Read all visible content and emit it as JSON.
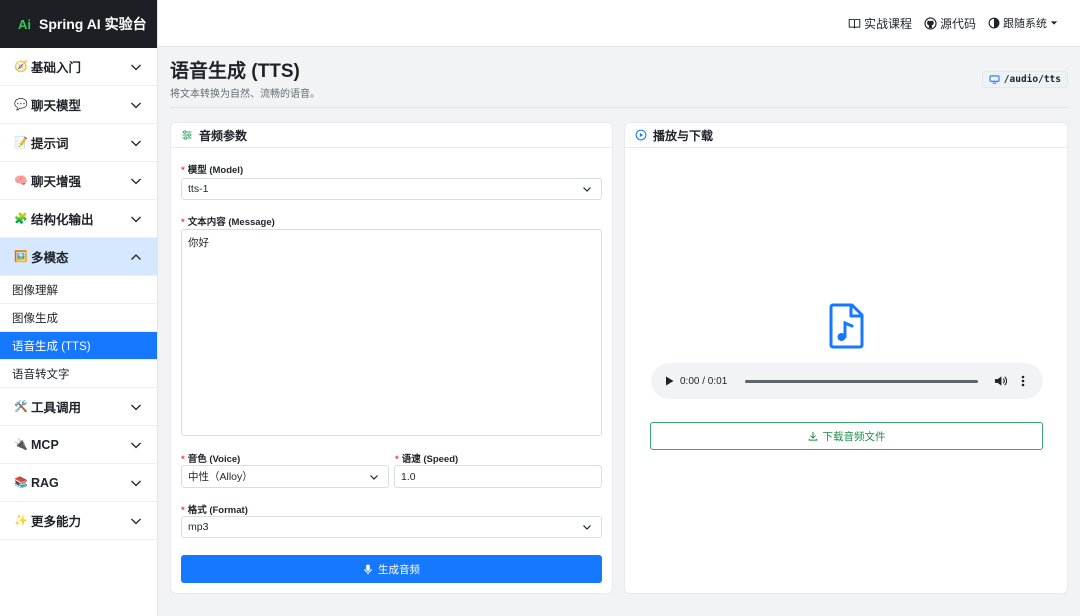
{
  "app": {
    "logo_mark": "Ai",
    "title": "Spring AI 实验台"
  },
  "sidebar": {
    "items": [
      {
        "emoji": "🧭",
        "label": "基础入门",
        "open": false
      },
      {
        "emoji": "💬",
        "label": "聊天模型",
        "open": false
      },
      {
        "emoji": "📝",
        "label": "提示词",
        "open": false
      },
      {
        "emoji": "🧠",
        "label": "聊天增强",
        "open": false
      },
      {
        "emoji": "🧩",
        "label": "结构化输出",
        "open": false
      },
      {
        "emoji": "🖼️",
        "label": "多模态",
        "open": true
      },
      {
        "emoji": "🛠️",
        "label": "工具调用",
        "open": false
      },
      {
        "emoji": "🔌",
        "label": "MCP",
        "open": false
      },
      {
        "emoji": "📚",
        "label": "RAG",
        "open": false
      },
      {
        "emoji": "✨",
        "label": "更多能力",
        "open": false
      }
    ],
    "sub_items": [
      "图像理解",
      "图像生成",
      "语音生成 (TTS)",
      "语音转文字"
    ],
    "active_sub": "语音生成 (TTS)"
  },
  "topbar": {
    "course": "实战课程",
    "source": "源代码",
    "theme": "跟随系统"
  },
  "page": {
    "title": "语音生成 (TTS)",
    "subtitle": "将文本转换为自然、流畅的语音。",
    "api_path": "/audio/tts"
  },
  "form": {
    "card_title": "音频参数",
    "model_label": "模型 (Model)",
    "model_value": "tts-1",
    "message_label": "文本内容 (Message)",
    "message_value": "你好",
    "voice_label": "音色 (Voice)",
    "voice_value": "中性（Alloy）",
    "speed_label": "语速 (Speed)",
    "speed_value": "1.0",
    "format_label": "格式 (Format)",
    "format_value": "mp3",
    "submit_label": "生成音频"
  },
  "player": {
    "card_title": "播放与下载",
    "time": "0:00 / 0:01",
    "download_label": "下载音频文件"
  },
  "colors": {
    "primary": "#1677ff",
    "download": "#1f8b4c",
    "sidebar_open": "#d6e8ff",
    "logo_bg": "#1d1f24"
  }
}
